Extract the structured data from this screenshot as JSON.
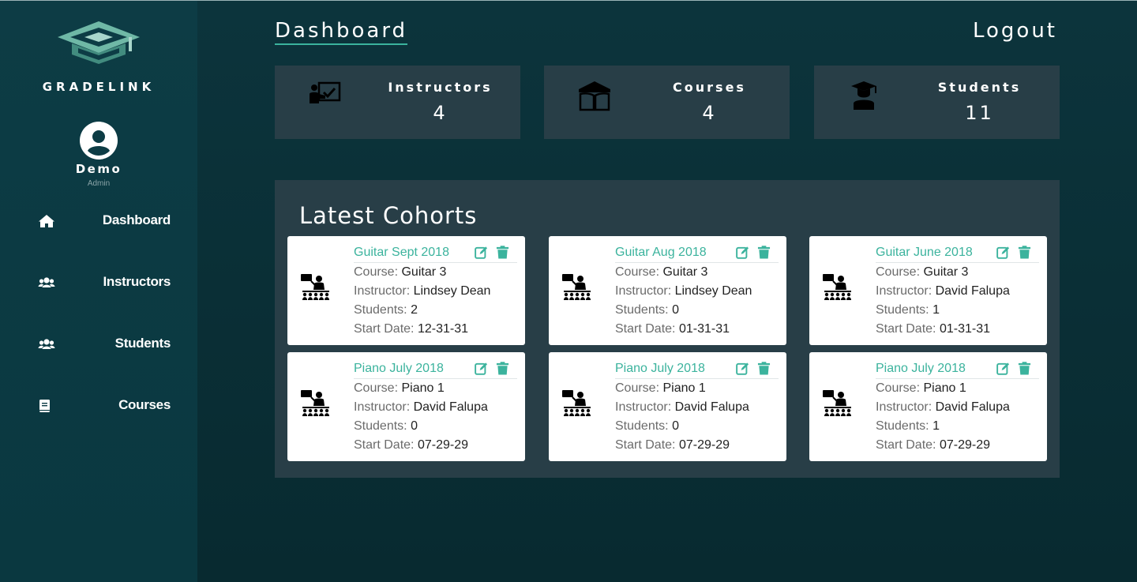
{
  "brand": {
    "name": "GRADELINK"
  },
  "user": {
    "name": "Demo",
    "role": "Admin"
  },
  "nav": [
    {
      "label": "Dashboard",
      "icon": "home-icon"
    },
    {
      "label": "Instructors",
      "icon": "users-icon"
    },
    {
      "label": "Students",
      "icon": "users-icon"
    },
    {
      "label": "Courses",
      "icon": "book-icon"
    }
  ],
  "header": {
    "title": "Dashboard",
    "logout_label": "Logout"
  },
  "stats": [
    {
      "label": "Instructors",
      "value": "4",
      "icon": "instructor-board-icon"
    },
    {
      "label": "Courses",
      "value": "4",
      "icon": "open-book-icon"
    },
    {
      "label": "Students",
      "value": "11",
      "icon": "graduate-icon"
    }
  ],
  "cohorts": {
    "title": "Latest Cohorts",
    "labels": {
      "course": "Course:",
      "instructor": "Instructor:",
      "students": "Students:",
      "start": "Start Date:"
    },
    "items": [
      {
        "name": "Guitar Sept 2018",
        "course": "Guitar 3",
        "instructor": "Lindsey Dean",
        "students": "2",
        "start": "12-31-31"
      },
      {
        "name": "Guitar Aug 2018",
        "course": "Guitar 3",
        "instructor": "Lindsey Dean",
        "students": "0",
        "start": "01-31-31"
      },
      {
        "name": "Guitar June 2018",
        "course": "Guitar 3",
        "instructor": "David Falupa",
        "students": "1",
        "start": "01-31-31"
      },
      {
        "name": "Piano July 2018",
        "course": "Piano 1",
        "instructor": "David Falupa",
        "students": "0",
        "start": "07-29-29"
      },
      {
        "name": "Piano July 2018",
        "course": "Piano 1",
        "instructor": "David Falupa",
        "students": "0",
        "start": "07-29-29"
      },
      {
        "name": "Piano July 2018",
        "course": "Piano 1",
        "instructor": "David Falupa",
        "students": "1",
        "start": "07-29-29"
      }
    ]
  },
  "colors": {
    "accent": "#3bb39d",
    "sidebar": "#0d3c45",
    "panel": "#283e47",
    "background": "#0a2f36"
  }
}
